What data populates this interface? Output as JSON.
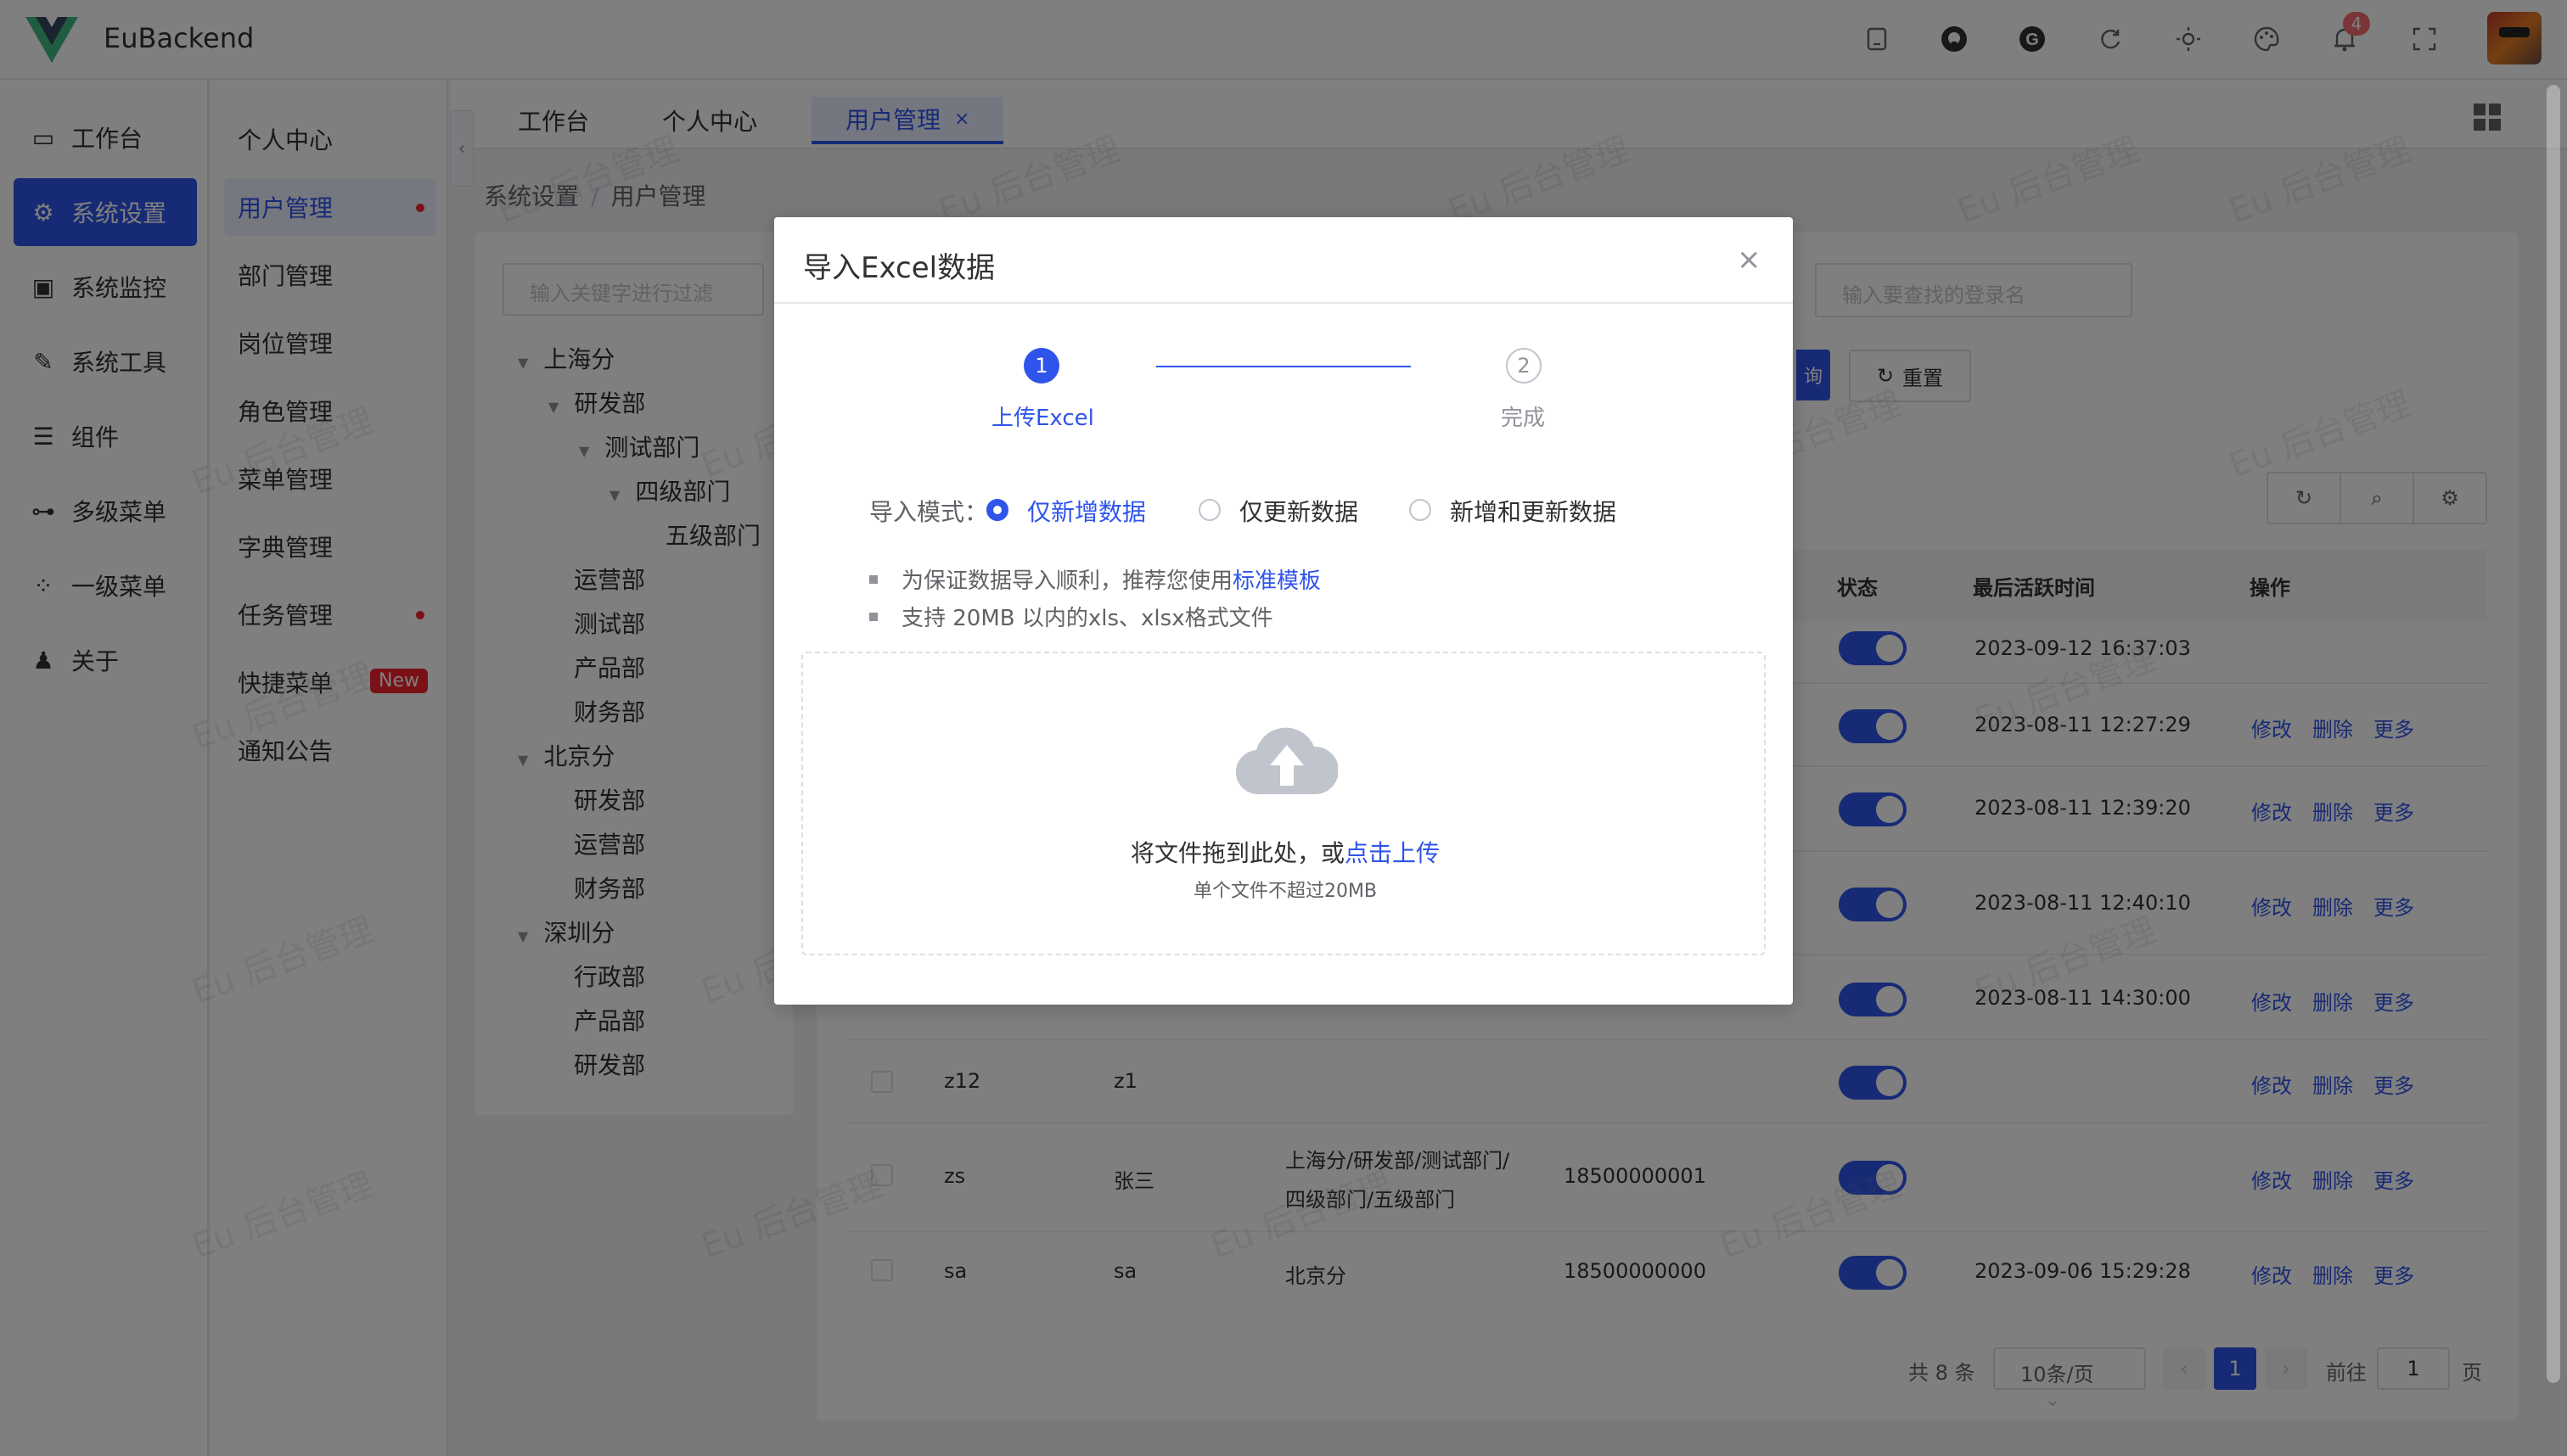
{
  "app": {
    "title": "EuBackend",
    "notification_count": "4"
  },
  "topbar_icons": [
    "tablet-icon",
    "github-icon",
    "g-icon",
    "refresh-icon",
    "sun-icon",
    "palette-icon",
    "bell-icon",
    "fullscreen-icon"
  ],
  "sidebar": {
    "items": [
      {
        "label": "工作台",
        "icon": "dashboard-icon"
      },
      {
        "label": "系统设置",
        "icon": "settings-icon"
      },
      {
        "label": "系统监控",
        "icon": "monitor-icon"
      },
      {
        "label": "系统工具",
        "icon": "wrench-icon"
      },
      {
        "label": "组件",
        "icon": "list-icon"
      },
      {
        "label": "多级菜单",
        "icon": "tree-icon"
      },
      {
        "label": "一级菜单",
        "icon": "grid-icon"
      },
      {
        "label": "关于",
        "icon": "user-icon"
      }
    ]
  },
  "submenu": {
    "items": [
      {
        "label": "个人中心"
      },
      {
        "label": "用户管理"
      },
      {
        "label": "部门管理"
      },
      {
        "label": "岗位管理"
      },
      {
        "label": "角色管理"
      },
      {
        "label": "菜单管理"
      },
      {
        "label": "字典管理"
      },
      {
        "label": "任务管理"
      },
      {
        "label": "快捷菜单",
        "badge": "New"
      },
      {
        "label": "通知公告"
      }
    ]
  },
  "tabs": [
    {
      "label": "工作台"
    },
    {
      "label": "个人中心"
    },
    {
      "label": "用户管理",
      "close": "×"
    }
  ],
  "breadcrumb": {
    "parent": "系统设置",
    "current": "用户管理",
    "separator": "/"
  },
  "tree": {
    "search_placeholder": "输入关键字进行过滤",
    "nodes": [
      "上海分",
      "研发部",
      "测试部门",
      "四级部门",
      "五级部门",
      "运营部",
      "测试部",
      "产品部",
      "财务部",
      "北京分",
      "研发部",
      "运营部",
      "财务部",
      "深圳分",
      "行政部",
      "产品部",
      "研发部"
    ]
  },
  "filters": {
    "login_placeholder": "输入要查找的登录名",
    "search_btn": "询",
    "reset_btn": "重置"
  },
  "table": {
    "headers": {
      "status": "状态",
      "last_active": "最后活跃时间",
      "actions": "操作"
    },
    "actions": {
      "edit": "修改",
      "delete": "删除",
      "more": "更多"
    },
    "rows": [
      {
        "time": "2023-09-12 16:37:03"
      },
      {
        "time": "2023-08-11 12:27:29"
      },
      {
        "time": "2023-08-11 12:39:20"
      },
      {
        "time": "2023-08-11 12:40:10"
      },
      {
        "time": "2023-08-11 14:30:00"
      },
      {
        "login": "z12",
        "name": "z1",
        "dept": "",
        "phone": "",
        "time": ""
      },
      {
        "login": "zs",
        "name": "张三",
        "dept_line1": "上海分/研发部/测试部门/",
        "dept_line2": "四级部门/五级部门",
        "phone": "18500000001",
        "time": ""
      },
      {
        "login": "sa",
        "name": "sa",
        "dept": "北京分",
        "phone": "18500000000",
        "time": "2023-09-06 15:29:28"
      }
    ]
  },
  "pagination": {
    "total": "共 8 条",
    "page_size": "10条/页",
    "current_page": "1",
    "goto_label": "前往",
    "goto_value": "1",
    "page_suffix": "页"
  },
  "watermark_text": "Eu 后台管理",
  "dialog": {
    "title": "导入Excel数据",
    "close": "×",
    "steps": [
      {
        "num": "1",
        "label": "上传Excel"
      },
      {
        "num": "2",
        "label": "完成"
      }
    ],
    "mode_label": "导入模式：",
    "modes": [
      "仅新增数据",
      "仅更新数据",
      "新增和更新数据"
    ],
    "selected_mode": "仅新增数据",
    "tips": {
      "tip1_prefix": "为保证数据导入顺利，推荐您使用",
      "tip1_link": "标准模板",
      "tip2": "支持 20MB 以内的xls、xlsx格式文件"
    },
    "upload": {
      "text_prefix": "将文件拖到此处，或",
      "text_link": "点击上传",
      "sub": "单个文件不超过20MB"
    }
  },
  "colors": {
    "primary": "#2f54eb",
    "danger": "#f5222d",
    "overlay": "rgba(0,0,0,0.5)"
  }
}
